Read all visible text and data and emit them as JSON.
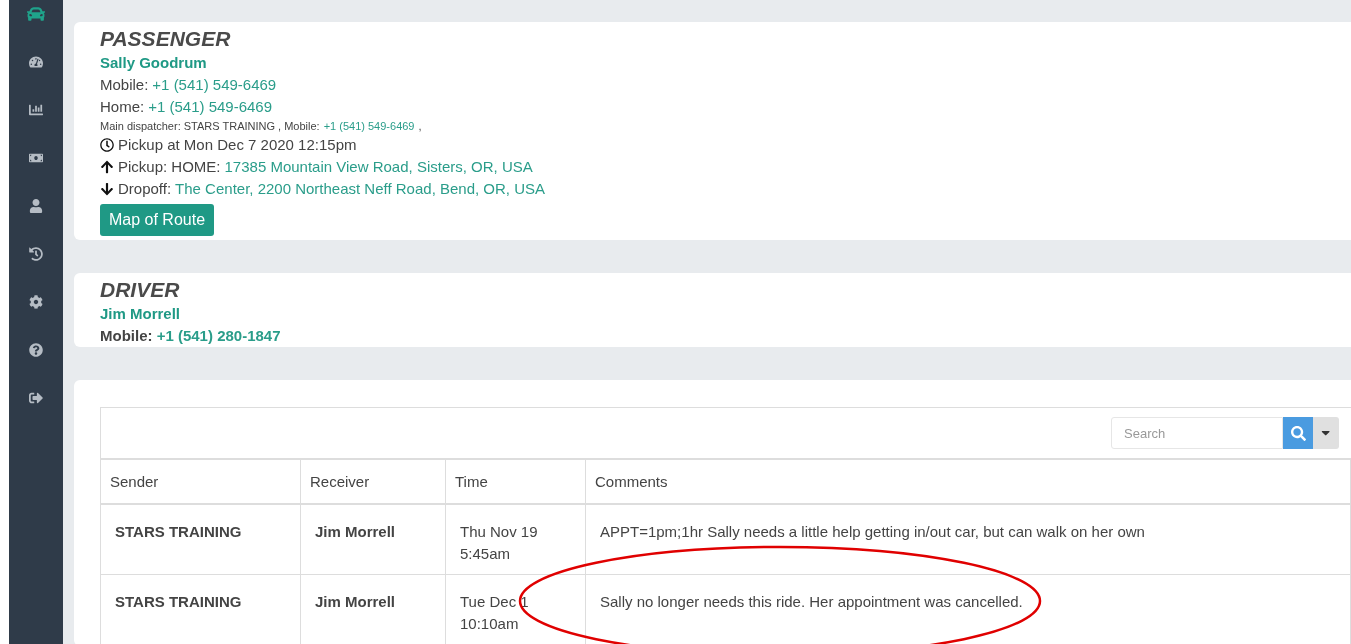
{
  "sidebar": {
    "items": [
      {
        "kind": "car",
        "selected": true
      },
      {
        "kind": "dashboard",
        "selected": false
      },
      {
        "kind": "chart",
        "selected": false
      },
      {
        "kind": "money",
        "selected": false
      },
      {
        "kind": "user",
        "selected": false
      },
      {
        "kind": "history",
        "selected": false
      },
      {
        "kind": "settings",
        "selected": false
      },
      {
        "kind": "help",
        "selected": false
      },
      {
        "kind": "logout",
        "selected": false
      }
    ]
  },
  "passenger": {
    "heading": "PASSENGER",
    "name": "Sally Goodrum",
    "lines": [
      {
        "kind": "phone",
        "label": "Mobile:",
        "value": "+1 (541) 549-6469"
      },
      {
        "kind": "phone",
        "label": "Home:",
        "value": "+1 (541) 549-6469"
      },
      {
        "kind": "small",
        "label": "Main dispatcher: STARS TRAINING , Mobile:",
        "value": "+1 (541) 549-6469",
        "suffix": ","
      },
      {
        "kind": "time",
        "label": "Pickup at Mon Dec 7 2020 12:15pm"
      },
      {
        "kind": "pickup",
        "label": "Pickup: HOME:",
        "value": "17385 Mountain View Road, Sisters, OR, USA"
      },
      {
        "kind": "dropoff",
        "label": "Dropoff:",
        "value": "The Center, 2200 Northeast Neff Road, Bend, OR, USA"
      }
    ],
    "button": "Map of Route"
  },
  "driver": {
    "heading": "DRIVER",
    "name": "Jim Morrell",
    "mobile_label": "Mobile:",
    "mobile": "+1 (541) 280-1847"
  },
  "messages": {
    "search": {
      "placeholder": "Search"
    },
    "columns": [
      "Sender",
      "Receiver",
      "Time",
      "Comments"
    ],
    "rows": [
      {
        "sender": "STARS TRAINING",
        "receiver": "Jim Morrell",
        "time": [
          "Thu Nov 19",
          "5:45am"
        ],
        "comment": "APPT=1pm;1hr Sally needs a little help getting in/out car, but can walk on her own"
      },
      {
        "sender": "STARS TRAINING",
        "receiver": "Jim Morrell",
        "time": [
          "Tue Dec 1",
          "10:10am"
        ],
        "comment": "Sally no longer needs this ride. Her appointment was cancelled."
      }
    ]
  },
  "annotation": {
    "kind": "ellipse"
  }
}
